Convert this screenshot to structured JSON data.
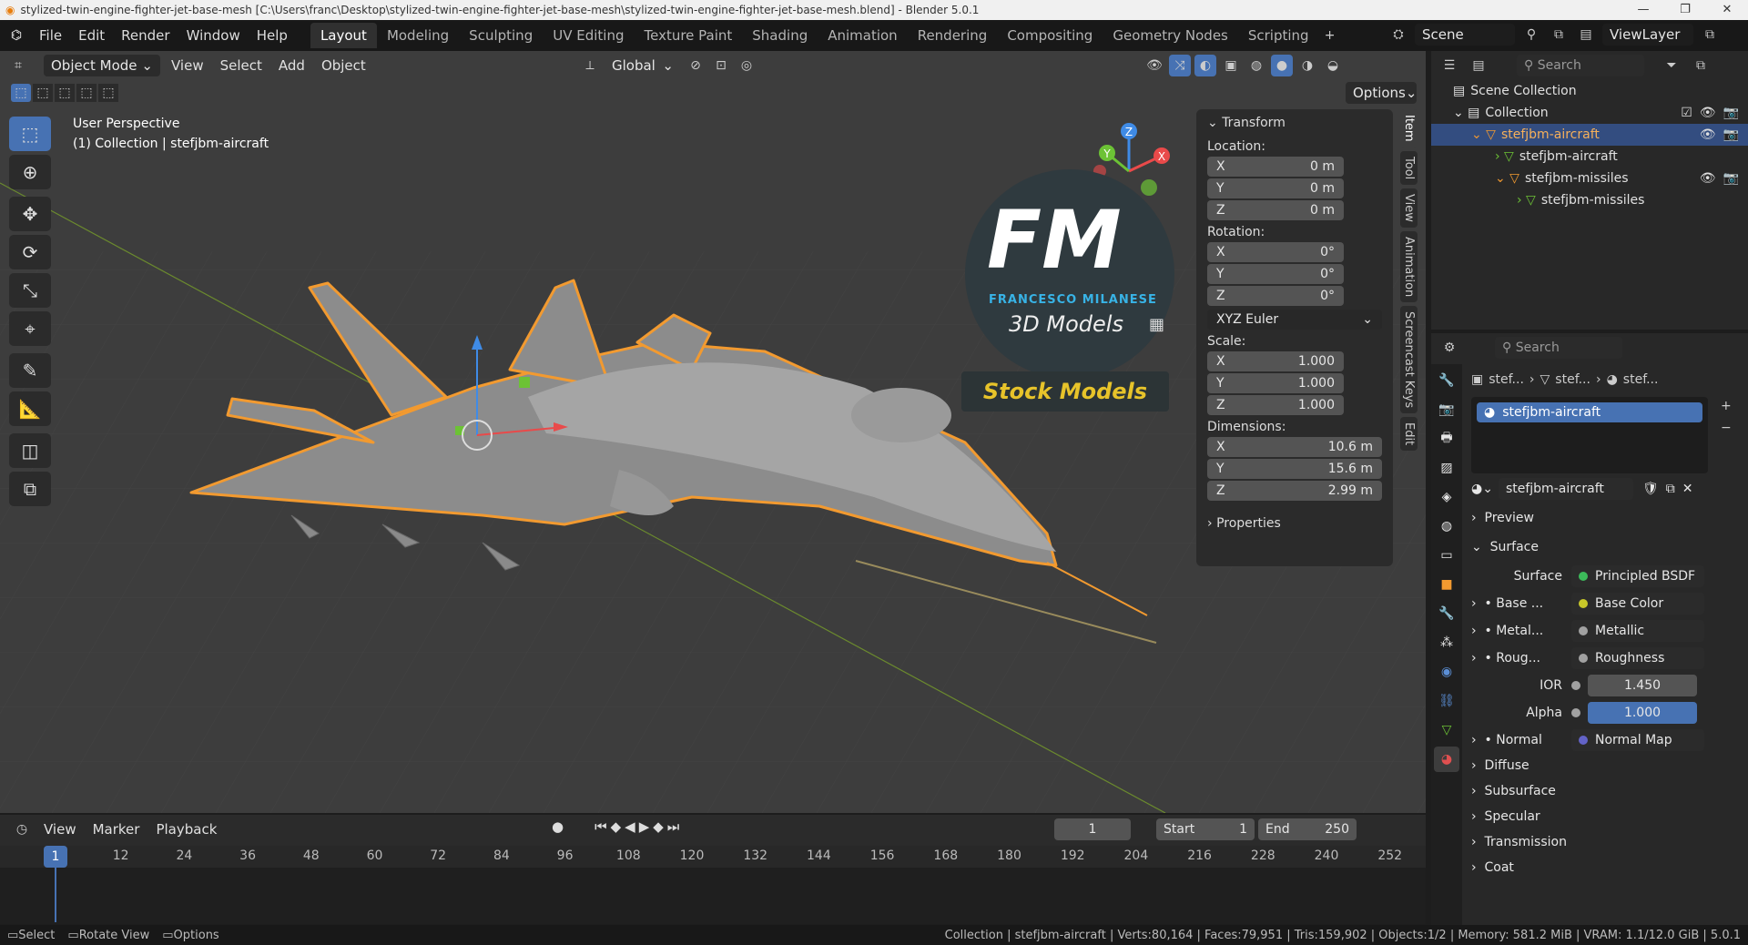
{
  "titlebar": {
    "title": "stylized-twin-engine-fighter-jet-base-mesh [C:\\Users\\franc\\Desktop\\stylized-twin-engine-fighter-jet-base-mesh\\stylized-twin-engine-fighter-jet-base-mesh.blend] - Blender 5.0.1"
  },
  "menubar": [
    "File",
    "Edit",
    "Render",
    "Window",
    "Help"
  ],
  "workspaces": [
    "Layout",
    "Modeling",
    "Sculpting",
    "UV Editing",
    "Texture Paint",
    "Shading",
    "Animation",
    "Rendering",
    "Compositing",
    "Geometry Nodes",
    "Scripting"
  ],
  "topright": {
    "scene": "Scene",
    "viewlayer": "ViewLayer"
  },
  "viewport": {
    "mode": "Object Mode",
    "menus": [
      "View",
      "Select",
      "Add",
      "Object"
    ],
    "transform_orientation": "Global",
    "options": "Options",
    "perspective": "User Perspective",
    "collection_info": "(1) Collection | stefjbm-aircraft",
    "watermark": {
      "title": "FM",
      "subtitle": "FRANCESCO MILANESE",
      "models": "3D Models",
      "stock": "Stock Models"
    },
    "gizmo": {
      "x": "X",
      "y": "Y",
      "z": "Z"
    }
  },
  "npanel": {
    "transform_label": "Transform",
    "location_label": "Location:",
    "location": [
      {
        "axis": "X",
        "value": "0 m"
      },
      {
        "axis": "Y",
        "value": "0 m"
      },
      {
        "axis": "Z",
        "value": "0 m"
      }
    ],
    "rotation_label": "Rotation:",
    "rotation": [
      {
        "axis": "X",
        "value": "0°"
      },
      {
        "axis": "Y",
        "value": "0°"
      },
      {
        "axis": "Z",
        "value": "0°"
      }
    ],
    "rotation_mode": "XYZ Euler",
    "scale_label": "Scale:",
    "scale": [
      {
        "axis": "X",
        "value": "1.000"
      },
      {
        "axis": "Y",
        "value": "1.000"
      },
      {
        "axis": "Z",
        "value": "1.000"
      }
    ],
    "dimensions_label": "Dimensions:",
    "dimensions": [
      {
        "axis": "X",
        "value": "10.6 m"
      },
      {
        "axis": "Y",
        "value": "15.6 m"
      },
      {
        "axis": "Z",
        "value": "2.99 m"
      }
    ],
    "properties_label": "Properties",
    "tabs": [
      "Item",
      "Tool",
      "View",
      "Animation",
      "Screencast Keys",
      "Edit"
    ]
  },
  "outliner": {
    "search_placeholder": "Search",
    "scene_collection": "Scene Collection",
    "collection": "Collection",
    "items": [
      "stefjbm-aircraft",
      "stefjbm-aircraft",
      "stefjbm-missiles",
      "stefjbm-missiles"
    ]
  },
  "properties": {
    "search_placeholder": "Search",
    "breadcrumb": [
      "stef...",
      "stef...",
      "stef..."
    ],
    "material_slot": "stefjbm-aircraft",
    "material_name": "stefjbm-aircraft",
    "preview_label": "Preview",
    "surface_section": "Surface",
    "surface_label": "Surface",
    "surface_value": "Principled BSDF",
    "inputs": [
      {
        "label": "Base ...",
        "value": "Base Color",
        "color": "#c7c729"
      },
      {
        "label": "Metal...",
        "value": "Metallic",
        "color": "#a1a1a1"
      },
      {
        "label": "Roug...",
        "value": "Roughness",
        "color": "#a1a1a1"
      }
    ],
    "ior_label": "IOR",
    "ior_value": "1.450",
    "alpha_label": "Alpha",
    "alpha_value": "1.000",
    "normal_label": "Normal",
    "normal_value": "Normal Map",
    "subsections": [
      "Diffuse",
      "Subsurface",
      "Specular",
      "Transmission",
      "Coat"
    ]
  },
  "timeline": {
    "menus": [
      "View",
      "Marker",
      "Playback"
    ],
    "current_frame": "1",
    "start_label": "Start",
    "start_value": "1",
    "end_label": "End",
    "end_value": "250",
    "ticks": [
      "1",
      "12",
      "24",
      "36",
      "48",
      "60",
      "72",
      "84",
      "96",
      "108",
      "120",
      "132",
      "144",
      "156",
      "168",
      "180",
      "192",
      "204",
      "216",
      "228",
      "240",
      "252"
    ]
  },
  "statusbar": {
    "left": [
      "Select",
      "Rotate View",
      "Options"
    ],
    "right": "Collection | stefjbm-aircraft | Verts:80,164 | Faces:79,951 | Tris:159,902 | Objects:1/2 | Memory: 581.2 MiB | VRAM: 1.1/12.0 GiB | 5.0.1"
  }
}
